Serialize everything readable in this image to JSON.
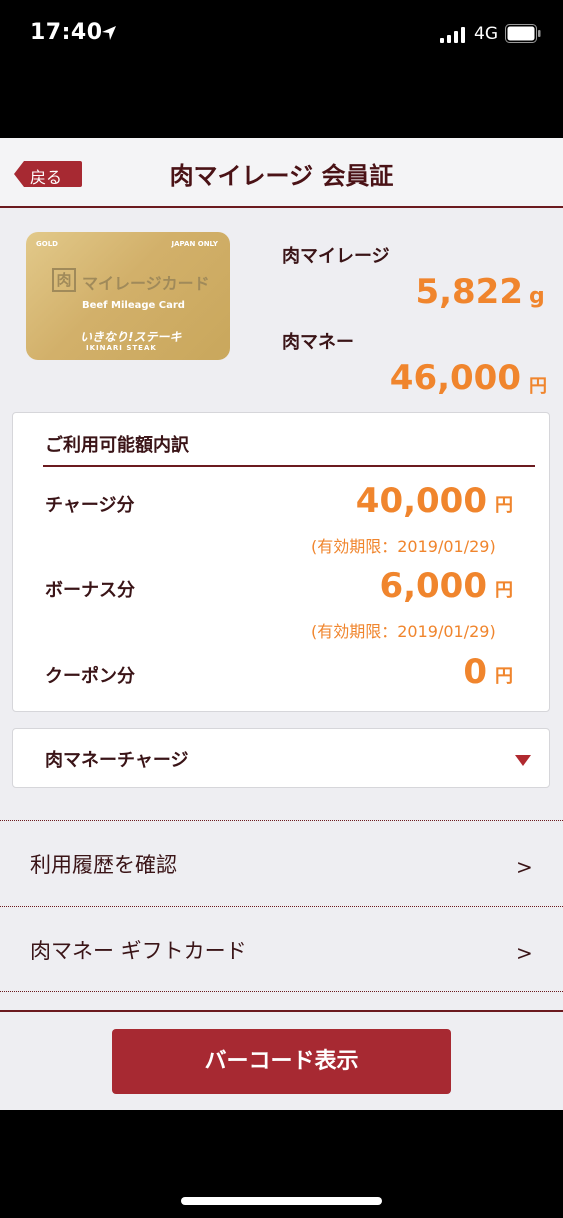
{
  "status_bar": {
    "time": "17:40",
    "network": "4G"
  },
  "header": {
    "back_label": "戻る",
    "title": "肉マイレージ 会員証"
  },
  "card": {
    "gold": "GOLD",
    "japan_only": "JAPAN ONLY",
    "icon_char": "肉",
    "name": "マイレージカード",
    "subtitle": "Beef Mileage Card",
    "brand": "いきなり!ステーキ",
    "brand_sub": "IKINARI STEAK"
  },
  "summary": {
    "mileage_label": "肉マイレージ",
    "mileage_value": "5,822",
    "mileage_unit": "g",
    "money_label": "肉マネー",
    "money_value": "46,000",
    "money_unit": "円"
  },
  "breakdown": {
    "title": "ご利用可能額内訳",
    "rows": [
      {
        "label": "チャージ分",
        "value": "40,000",
        "unit": "円",
        "expiry": "(有効期限：2019/01/29)"
      },
      {
        "label": "ボーナス分",
        "value": "6,000",
        "unit": "円",
        "expiry": "(有効期限：2019/01/29)"
      },
      {
        "label": "クーポン分",
        "value": "0",
        "unit": "円"
      }
    ]
  },
  "charge": {
    "label": "肉マネーチャージ",
    "icon": "triangle-down-icon"
  },
  "menu": [
    {
      "label": "利用履歴を確認",
      "chevron": ">"
    },
    {
      "label": "肉マネー ギフトカード",
      "chevron": ">"
    }
  ],
  "barcode_button": "バーコード表示",
  "colors": {
    "accent": "#f0852d",
    "brand": "#a72932",
    "dark_text": "#3a1417",
    "divider": "#6b1a1f",
    "background": "#eeeef2"
  }
}
